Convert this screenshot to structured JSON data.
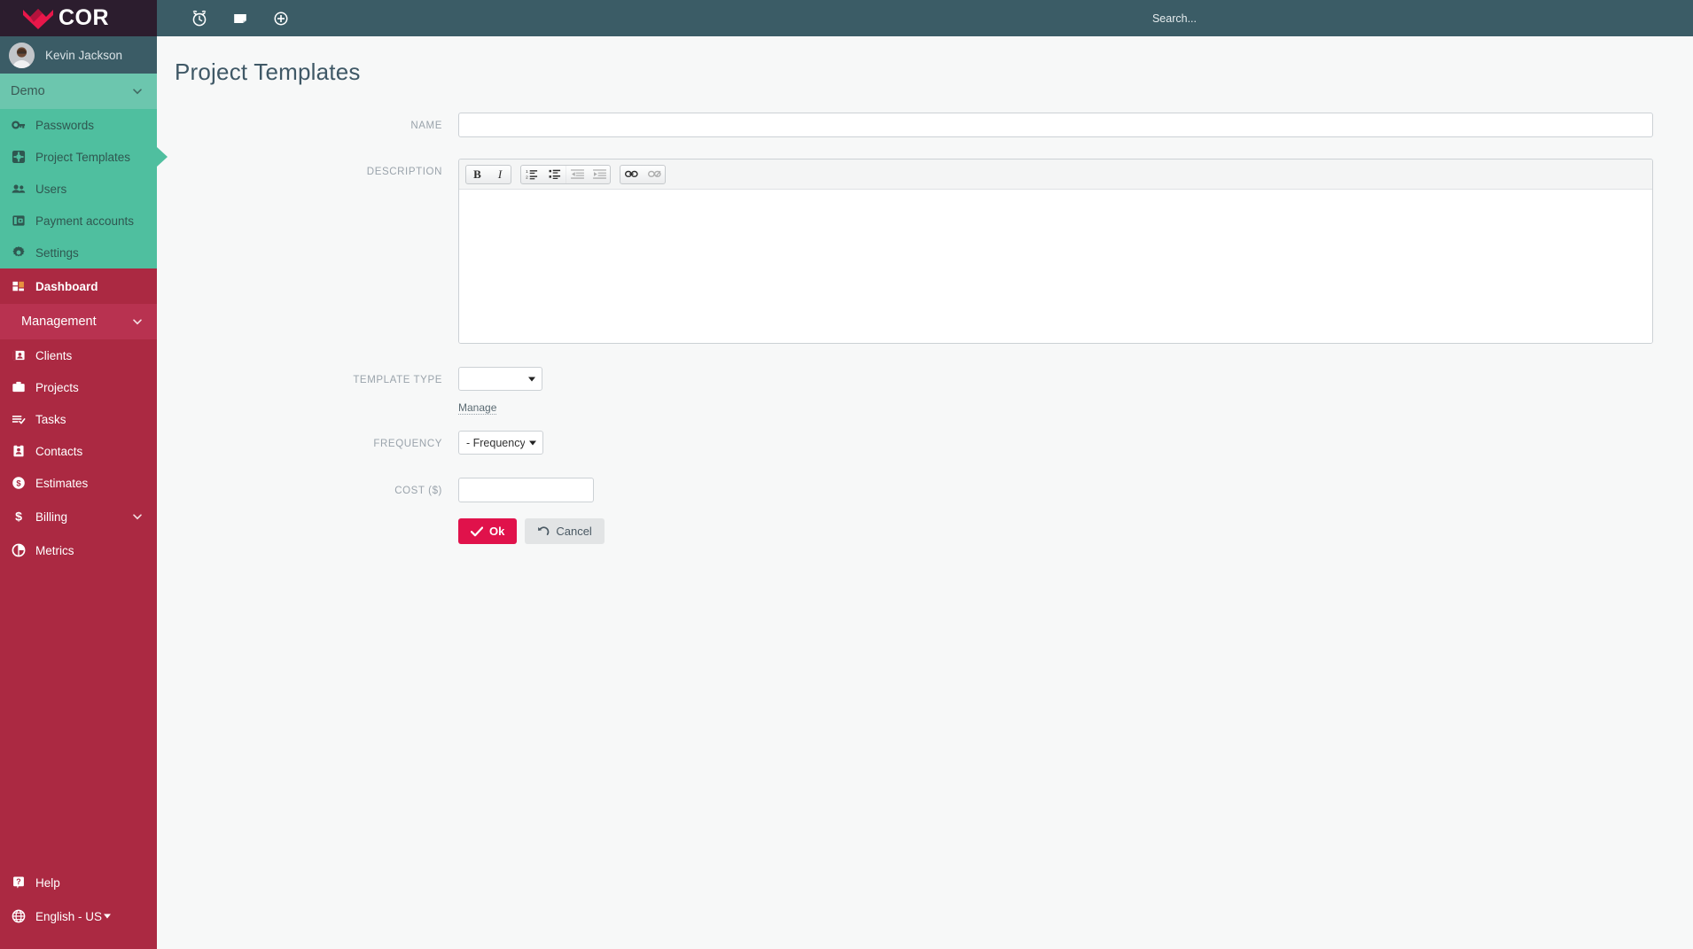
{
  "brand": {
    "logo_text": "COR",
    "logo_bg": "#2c1d2e",
    "accent_red": "#ab2942",
    "accent_teal": "#4fbf9f",
    "primary_button_color": "#e0124b"
  },
  "user": {
    "name": "Kevin Jackson",
    "avatar_icon": "user-avatar"
  },
  "topbar": {
    "icons": [
      {
        "name": "alarm-clock-icon"
      },
      {
        "name": "file-icon"
      },
      {
        "name": "plus-circle-icon"
      }
    ],
    "search_placeholder": "Search..."
  },
  "sidebar": {
    "groups": [
      {
        "header": {
          "label": "Demo",
          "theme": "teal",
          "caret": "chevron-down-icon"
        },
        "theme": "teal",
        "items": [
          {
            "label": "Passwords",
            "icon": "key-icon",
            "active": false
          },
          {
            "label": "Project Templates",
            "icon": "template-icon",
            "active": true
          },
          {
            "label": "Users",
            "icon": "users-icon",
            "active": false
          },
          {
            "label": "Payment accounts",
            "icon": "payment-card-icon",
            "active": false
          },
          {
            "label": "Settings",
            "icon": "gear-icon",
            "active": false
          }
        ]
      },
      {
        "header": null,
        "theme": "red",
        "items": [
          {
            "label": "Dashboard",
            "icon": "dashboard-icon",
            "bold": true,
            "active": false
          }
        ]
      },
      {
        "header": {
          "label": "Management",
          "theme": "red",
          "caret": "chevron-down-icon"
        },
        "theme": "red",
        "items": [
          {
            "label": "Clients",
            "icon": "clients-icon",
            "active": false
          },
          {
            "label": "Projects",
            "icon": "briefcase-icon",
            "active": false
          },
          {
            "label": "Tasks",
            "icon": "tasks-icon",
            "active": false
          },
          {
            "label": "Contacts",
            "icon": "contacts-icon",
            "active": false
          },
          {
            "label": "Estimates",
            "icon": "dollar-circle-icon",
            "active": false
          },
          {
            "label": "Billing",
            "icon": "dollar-icon",
            "active": false,
            "caret": true
          },
          {
            "label": "Metrics",
            "icon": "pie-chart-icon",
            "active": false
          }
        ]
      }
    ],
    "bottom": [
      {
        "label": "Help",
        "icon": "help-icon"
      },
      {
        "label": "English - US",
        "icon": "globe-icon",
        "caret": true
      }
    ]
  },
  "page": {
    "title": "Project Templates"
  },
  "form": {
    "name": {
      "label": "NAME",
      "value": "",
      "placeholder": ""
    },
    "description": {
      "label": "DESCRIPTION",
      "value": "",
      "toolbar": [
        {
          "name": "bold-icon",
          "glyph": "B",
          "disabled": false
        },
        {
          "name": "italic-icon",
          "glyph": "I",
          "disabled": false
        },
        {
          "name": "numbered-list-icon",
          "disabled": false
        },
        {
          "name": "bullet-list-icon",
          "disabled": false
        },
        {
          "name": "outdent-icon",
          "disabled": true
        },
        {
          "name": "indent-icon",
          "disabled": true
        },
        {
          "name": "link-icon",
          "disabled": false
        },
        {
          "name": "unlink-icon",
          "disabled": true
        }
      ]
    },
    "template_type": {
      "label": "TEMPLATE TYPE",
      "value": "",
      "manage_link": "Manage"
    },
    "frequency": {
      "label": "FREQUENCY",
      "value": "- Frequency -"
    },
    "cost": {
      "label": "COST ($)",
      "value": "",
      "placeholder": ""
    },
    "buttons": {
      "ok": "Ok",
      "cancel": "Cancel"
    }
  }
}
